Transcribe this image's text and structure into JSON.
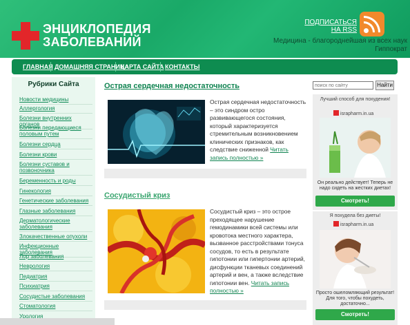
{
  "header": {
    "logo_line1": "ЭНЦИКЛОПЕДИЯ",
    "logo_line2": "ЗАБОЛЕВАНИЙ",
    "subscribe_line1": "ПОДПИСАТЬСЯ",
    "subscribe_line2": "НА RSS",
    "motto_line1": "Медицина - благороднейшая из всех наук",
    "motto_line2": "Гиппократ"
  },
  "nav": {
    "items": [
      "ГЛАВНАЯ",
      "ДОМАШНЯЯ СТРАНИЦА",
      "КАРТА САЙТА",
      "КОНТАКТЫ"
    ]
  },
  "sidebar": {
    "title": "Рубрики Сайта",
    "items": [
      "Новости медицины",
      "Аллергология",
      "Болезни внутренних органов",
      "Болезни передающиеся половым путем",
      "Болезни сердца",
      "Болезни крови",
      "Болезни суставов и позвоночника",
      "Беременность и роды",
      "Гинекология",
      "Генетические заболевания",
      "Глазные заболевания",
      "Дерматологические заболевания",
      "Злокачественные опухоли",
      "Инфекционные заболевания",
      "Лор заболевания",
      "Неврология",
      "Педиатрия",
      "Психиатрия",
      "Сосудистые заболевания",
      "Стоматология",
      "Урология"
    ]
  },
  "articles": [
    {
      "title": "Острая сердечная недостаточность",
      "text": "Острая сердечная недостаточность – это синдром остро развивающегося состояния, который характеризуется стремительным возникновением клинических признаков, как следствие сниженной",
      "more": "Читать запись полностью »"
    },
    {
      "title": "Сосудистый криз",
      "text": "Сосудистый криз – это острое преходящее нарушение гемодинамики всей системы или кровотока местного характера, вызванное расстройствами тонуса сосудов, то есть в результате гипотонии или гипертонии артерий, дисфункции тканевых соединений артерий и вен, а также вследствие гипотонии вен.",
      "more": "Читать запись полностью »"
    }
  ],
  "search": {
    "placeholder": "поиск по сайту",
    "button": "Найти"
  },
  "ads": [
    {
      "headline": "Лучший способ для похудения!",
      "source": "israpharm.in.ua",
      "caption": "Он реально действует! Теперь не надо сидеть на жестких диетах!",
      "button": "Смотреть!"
    },
    {
      "headline": "Я похудела без диеты!",
      "source": "israpharm.in.ua",
      "caption": "Просто ошеломляющий результат! Для того, чтобы похудеть, достаточно...",
      "button": "Смотреть!"
    }
  ],
  "colors": {
    "header_green": "#1aa968",
    "nav_green": "#0e8c50",
    "cross_red": "#e2262a",
    "rss_orange": "#f1892c",
    "button_green": "#2fa84a"
  }
}
